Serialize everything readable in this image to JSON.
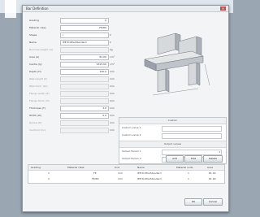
{
  "window": {
    "title": "Bar Definition"
  },
  "form": {
    "rows": [
      {
        "label": "Grading",
        "value": "0",
        "unit": "",
        "dim": false
      },
      {
        "label": "Material class",
        "value": "FE/RS",
        "unit": "",
        "dim": false
      },
      {
        "label": "Shape",
        "value": "I",
        "unit": "",
        "dim": false,
        "left": true
      },
      {
        "label": "Name",
        "value": "IPE Profile/Standard",
        "unit": "",
        "dim": false,
        "left": true
      },
      {
        "label": "Nominal weight (G)",
        "value": "",
        "unit": "kg",
        "dim": true
      },
      {
        "label": "Area (A)",
        "value": "81.00",
        "unit": "cm²",
        "dim": false
      },
      {
        "label": "Inertia (Iy)",
        "value": "4315.00",
        "unit": "cm⁴",
        "dim": false
      },
      {
        "label": "Depth (H)",
        "value": "120.0",
        "unit": "mm",
        "dim": false
      },
      {
        "label": "Web height (h)",
        "value": "",
        "unit": "mm",
        "dim": true
      },
      {
        "label": "Web thick. (tw)",
        "value": "",
        "unit": "mm",
        "dim": true
      },
      {
        "label": "Flange width (B)",
        "value": "",
        "unit": "mm",
        "dim": true
      },
      {
        "label": "Flange thick. (tf)",
        "value": "",
        "unit": "mm",
        "dim": true
      },
      {
        "label": "Thickness (T)",
        "value": "3.0",
        "unit": "mm",
        "dim": false
      },
      {
        "label": "Width (W)",
        "value": "0.0",
        "unit": "mm",
        "dim": false
      },
      {
        "label": "Radius (R)",
        "value": "",
        "unit": "mm",
        "dim": true
      },
      {
        "label": "Centroid (Cx)",
        "value": "",
        "unit": "mm",
        "dim": true
      }
    ]
  },
  "side_panel": {
    "header": "Custom",
    "custom_label_1": "Custom value 1",
    "custom_label_2": "Custom value 2",
    "sub_header": "Output values",
    "output_label_1": "Output Param 1",
    "output_label_2": "Output Param 2"
  },
  "actions": {
    "add": "Add",
    "edit": "Edit",
    "delete": "Delete",
    "ok": "OK",
    "cancel": "Cancel"
  },
  "table": {
    "headers": [
      "Grading",
      "Material class",
      "Unit",
      "Name",
      "Material units",
      "Area"
    ],
    "rows": [
      [
        "1",
        "FE",
        "mm",
        "IPE Profile/Standard",
        "1",
        "81.00"
      ],
      [
        "2",
        "FE/RS",
        "mm",
        "IPE Profile/Standard",
        "1",
        "81.00"
      ]
    ]
  },
  "colors": {
    "accent_close": "#c94c4c",
    "window_bg": "#f3f4f6",
    "backdrop": "#9aa7b3"
  },
  "icons": {
    "close": "close-icon",
    "dropdown": "chevron-down-icon"
  }
}
